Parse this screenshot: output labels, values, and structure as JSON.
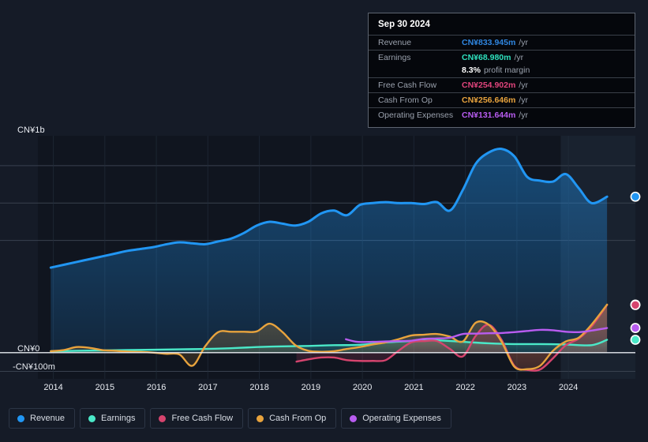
{
  "axes": {
    "y_labels": {
      "top": "CN¥1b",
      "zero": "CN¥0",
      "negative": "-CN¥100m"
    },
    "x_labels": [
      "2014",
      "2015",
      "2016",
      "2017",
      "2018",
      "2019",
      "2020",
      "2021",
      "2022",
      "2023",
      "2024"
    ]
  },
  "tooltip": {
    "date": "Sep 30 2024",
    "rows": [
      {
        "label": "Revenue",
        "value": "CN¥833.945m",
        "unit": "/yr",
        "color": "#2f86e0"
      },
      {
        "label": "Earnings",
        "value": "CN¥68.980m",
        "unit": "/yr",
        "color": "#2ee0bd"
      },
      {
        "label": "",
        "value": "8.3%",
        "unit": "profit margin",
        "color": "#ffffff"
      },
      {
        "label": "Free Cash Flow",
        "value": "CN¥254.902m",
        "unit": "/yr",
        "color": "#e0447c"
      },
      {
        "label": "Cash From Op",
        "value": "CN¥256.646m",
        "unit": "/yr",
        "color": "#e8a33d"
      },
      {
        "label": "Operating Expenses",
        "value": "CN¥131.644m",
        "unit": "/yr",
        "color": "#b85cf0"
      }
    ]
  },
  "legend": [
    {
      "label": "Revenue",
      "color": "#2196f3"
    },
    {
      "label": "Earnings",
      "color": "#4ae8c8"
    },
    {
      "label": "Free Cash Flow",
      "color": "#d6446e"
    },
    {
      "label": "Cash From Op",
      "color": "#e8a33d"
    },
    {
      "label": "Operating Expenses",
      "color": "#b85cf0"
    }
  ],
  "chart_data": {
    "type": "line",
    "title": "",
    "xlabel": "",
    "ylabel": "",
    "currency": "CNY",
    "xlim": [
      2013.7,
      2025.3
    ],
    "ylim": [
      -140,
      1160
    ],
    "grid": true,
    "gridlines": [
      1000,
      800,
      600,
      0,
      -100
    ],
    "legend_position": "bottom",
    "latest_period": "Sep 30 2024",
    "forecast_band_start": 2023.85,
    "series": [
      {
        "name": "Revenue",
        "color": "#2196f3",
        "filled": true,
        "x": [
          2013.95,
          2014.2,
          2014.45,
          2014.7,
          2014.95,
          2015.2,
          2015.45,
          2015.7,
          2015.95,
          2016.2,
          2016.45,
          2016.7,
          2016.95,
          2017.2,
          2017.45,
          2017.7,
          2017.95,
          2018.2,
          2018.45,
          2018.7,
          2018.95,
          2019.2,
          2019.45,
          2019.7,
          2019.95,
          2020.2,
          2020.45,
          2020.7,
          2020.95,
          2021.2,
          2021.45,
          2021.7,
          2021.95,
          2022.2,
          2022.45,
          2022.7,
          2022.95,
          2023.2,
          2023.45,
          2023.7,
          2023.95,
          2024.2,
          2024.45,
          2024.75
        ],
        "values": [
          455,
          470,
          485,
          500,
          515,
          530,
          545,
          555,
          565,
          580,
          590,
          585,
          580,
          595,
          610,
          640,
          680,
          700,
          690,
          680,
          700,
          745,
          760,
          735,
          790,
          800,
          805,
          800,
          800,
          795,
          805,
          760,
          870,
          1010,
          1070,
          1090,
          1050,
          940,
          920,
          915,
          955,
          880,
          800,
          834
        ]
      },
      {
        "name": "Earnings",
        "color": "#4ae8c8",
        "filled": true,
        "x": [
          2013.95,
          2014.45,
          2014.95,
          2015.45,
          2015.95,
          2016.45,
          2016.95,
          2017.45,
          2017.95,
          2018.45,
          2018.95,
          2019.45,
          2019.95,
          2020.45,
          2020.95,
          2021.45,
          2021.95,
          2022.45,
          2022.95,
          2023.45,
          2023.95,
          2024.45,
          2024.75
        ],
        "values": [
          8,
          10,
          12,
          14,
          16,
          18,
          20,
          24,
          30,
          34,
          36,
          40,
          42,
          55,
          62,
          66,
          58,
          50,
          46,
          46,
          44,
          40,
          69
        ]
      },
      {
        "name": "Free Cash Flow",
        "color": "#d6446e",
        "filled": true,
        "x": [
          2018.72,
          2018.95,
          2019.2,
          2019.45,
          2019.7,
          2019.95,
          2020.2,
          2020.45,
          2020.7,
          2020.95,
          2021.2,
          2021.45,
          2021.7,
          2021.95,
          2022.2,
          2022.45,
          2022.7,
          2022.95,
          2023.2,
          2023.45,
          2023.7,
          2023.95,
          2024.2,
          2024.45,
          2024.75
        ],
        "values": [
          -48,
          -36,
          -26,
          -26,
          -40,
          -44,
          -44,
          -40,
          10,
          55,
          62,
          62,
          20,
          -20,
          90,
          150,
          70,
          -70,
          -92,
          -90,
          -30,
          40,
          75,
          140,
          255
        ]
      },
      {
        "name": "Cash From Op",
        "color": "#e8a33d",
        "filled": true,
        "x": [
          2013.95,
          2014.2,
          2014.45,
          2014.7,
          2014.95,
          2015.2,
          2015.45,
          2015.7,
          2015.95,
          2016.2,
          2016.45,
          2016.7,
          2016.95,
          2017.2,
          2017.45,
          2017.7,
          2017.95,
          2018.2,
          2018.45,
          2018.7,
          2018.95,
          2019.2,
          2019.45,
          2019.7,
          2019.95,
          2020.2,
          2020.45,
          2020.7,
          2020.95,
          2021.2,
          2021.45,
          2021.7,
          2021.95,
          2022.2,
          2022.45,
          2022.7,
          2022.95,
          2023.2,
          2023.45,
          2023.7,
          2023.95,
          2024.2,
          2024.45,
          2024.75
        ],
        "values": [
          8,
          14,
          30,
          26,
          14,
          10,
          6,
          4,
          0,
          -6,
          -10,
          -70,
          35,
          110,
          112,
          112,
          114,
          155,
          110,
          40,
          10,
          5,
          8,
          20,
          30,
          44,
          55,
          72,
          92,
          96,
          100,
          86,
          60,
          160,
          150,
          60,
          -75,
          -88,
          -70,
          10,
          60,
          80,
          150,
          257
        ]
      },
      {
        "name": "Operating Expenses",
        "color": "#b85cf0",
        "filled": false,
        "x": [
          2019.68,
          2019.9,
          2020.2,
          2020.45,
          2020.7,
          2020.95,
          2021.2,
          2021.45,
          2021.7,
          2021.95,
          2022.2,
          2022.45,
          2022.7,
          2022.95,
          2023.2,
          2023.45,
          2023.7,
          2023.95,
          2024.2,
          2024.45,
          2024.75
        ],
        "values": [
          72,
          58,
          58,
          60,
          62,
          64,
          74,
          76,
          80,
          100,
          102,
          104,
          105,
          110,
          116,
          122,
          120,
          112,
          110,
          118,
          132
        ]
      }
    ],
    "endpoints": [
      {
        "name": "Revenue",
        "value": 834,
        "color": "#2196f3"
      },
      {
        "name": "Cash From Op",
        "value": 257,
        "color": "#e8a33d"
      },
      {
        "name": "Free Cash Flow",
        "value": 255,
        "color": "#d6446e"
      },
      {
        "name": "Operating Expenses",
        "value": 132,
        "color": "#b85cf0"
      },
      {
        "name": "Earnings",
        "value": 69,
        "color": "#4ae8c8"
      }
    ]
  }
}
